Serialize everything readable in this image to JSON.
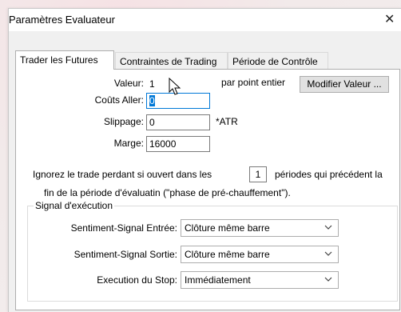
{
  "window": {
    "title": "Paramètres Evaluateur"
  },
  "tabs": [
    {
      "label": "Trader les Futures"
    },
    {
      "label": "Contraintes de Trading"
    },
    {
      "label": "Période de Contrôle"
    }
  ],
  "form": {
    "valeur_label": "Valeur:",
    "valeur_value": "1",
    "par_point_label": "par point entier",
    "modifier_button": "Modifier Valeur ...",
    "couts_label": "Coûts Aller:",
    "couts_value": "0",
    "slippage_label": "Slippage:",
    "slippage_value": "0",
    "slippage_unit": "*ATR",
    "marge_label": "Marge:",
    "marge_value": "16000",
    "ignore_text_1": "Ignorez le trade perdant si ouvert dans les",
    "ignore_value": "1",
    "ignore_text_2": "périodes qui précédent la",
    "ignore_text_3": "fin de la période d'évaluatin (\"phase de pré-chauffement\")."
  },
  "signal_group": {
    "legend": "Signal d'exécution",
    "entree_label": "Sentiment-Signal Entrée:",
    "entree_value": "Clôture même barre",
    "sortie_label": "Sentiment-Signal Sortie:",
    "sortie_value": "Clôture même barre",
    "stop_label": "Execution du Stop:",
    "stop_value": "Immédiatement"
  },
  "icons": {
    "close": "close-icon",
    "dropdown": "chevron-down-icon",
    "cursor": "mouse-pointer-icon"
  },
  "colors": {
    "focus_border": "#0078d7",
    "selection": "#0078d7",
    "dialog_bg": "#f0f0f0"
  }
}
